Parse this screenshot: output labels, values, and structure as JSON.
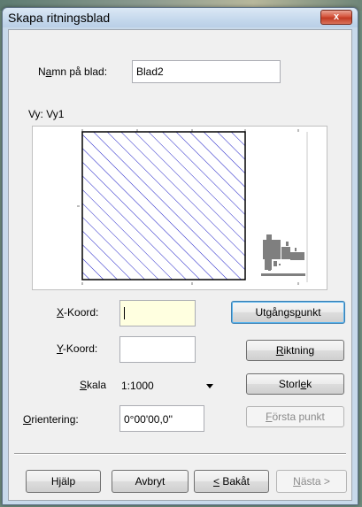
{
  "window": {
    "title": "Skapa ritningsblad",
    "close_glyph": "x"
  },
  "sheet_name": {
    "label": "Namn på blad:",
    "value": "Blad2"
  },
  "view": {
    "label": "Vy: Vy1"
  },
  "x_coord": {
    "label": "X-Koord:",
    "value": ""
  },
  "y_coord": {
    "label": "Y-Koord:",
    "value": ""
  },
  "scale": {
    "label": "Skala",
    "selected": "1:1000"
  },
  "orientation": {
    "label": "Orientering:",
    "value": "0°00'00,0''"
  },
  "side_buttons": {
    "origin": "Utgångspunkt",
    "direction": "Riktning",
    "size": "Storlek",
    "first_point": "Första punkt"
  },
  "footer": {
    "help": "Hjälp",
    "cancel": "Avbryt",
    "back": "< Bakåt",
    "next": "Nästa >"
  },
  "colors": {
    "hatch_blue": "#2020c8",
    "dialog_frame": "#c8d9ea",
    "client_bg": "#f0f0f0",
    "focused_field": "#ffffe0"
  }
}
